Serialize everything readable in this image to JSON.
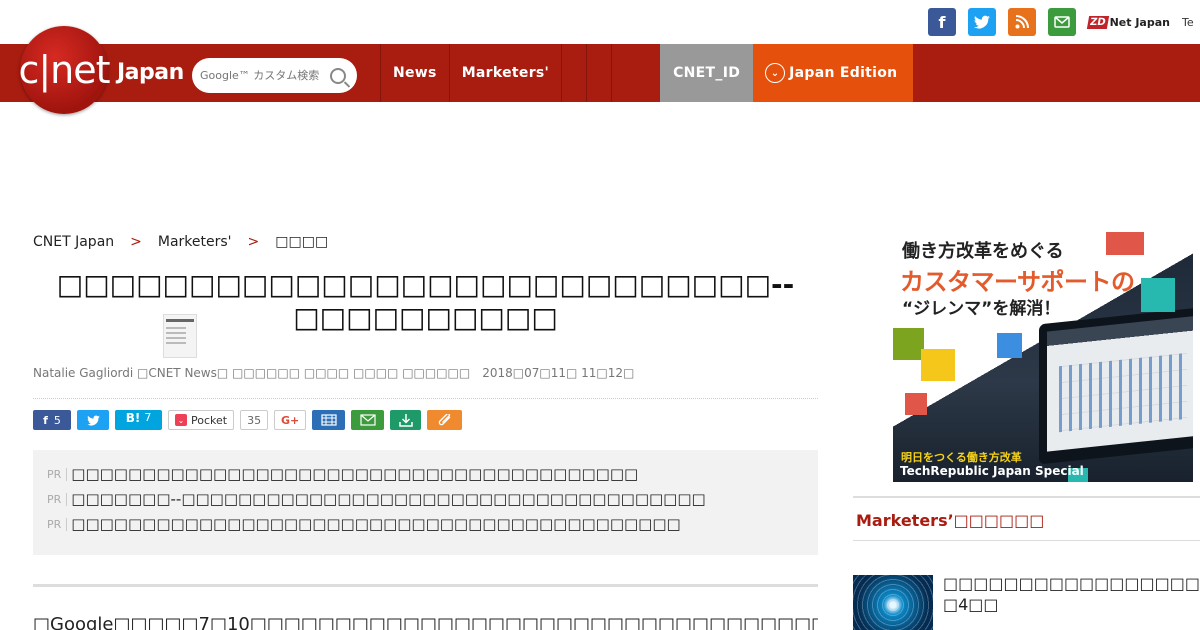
{
  "header_links": {
    "zdnet_label": "Net Japan",
    "zdnet_badge": "ZD",
    "techrepublic_label": "Te"
  },
  "logo": {
    "mark": "c|net",
    "edition": "Japan"
  },
  "search": {
    "placeholder": "Google™ カスタム検索"
  },
  "nav": {
    "items": [
      "News",
      "Marketers'"
    ],
    "cnet_id": "CNET_ID",
    "edition": "Japan Edition"
  },
  "breadcrumb": {
    "items": [
      "CNET Japan",
      "Marketers'",
      "□□□□"
    ],
    "separator": ">"
  },
  "article": {
    "title": "□□□□□□□□□□□□□□□□□□□□□□□□□□□--□□□□□□□□□□",
    "author": "Natalie Gagliordi □CNET News□ □□□□□□ □□□□ □□□□ □□□□□□",
    "date": "2018□07□11□ 11□12□",
    "share": {
      "facebook_count": "5",
      "hatena_count": "7",
      "pocket_label": "Pocket",
      "pocket_count": "35",
      "gplus_label": "G+"
    },
    "pr_items": [
      "□□□□□□□□□□□□□□□□□□□□□□□□□□□□□□□□□□□□□□□□",
      "□□□□□□□--□□□□□□□□□□□□□□□□□□□□□□□□□□□□□□□□□□□□□",
      "□□□□□□□□□□□□□□□□□□□□□□□□□□□□□□□□□□□□□□□□□□□"
    ],
    "pr_tag": "PR",
    "body_start": "□Google□□□□□7□10□□□□□□□□□□□□□□□□□□□□□□□□□□□□□□□□□□□□□",
    "body_link": "□□□□□□□□",
    "body_end": "□□□□□□□"
  },
  "ad": {
    "line1": "働き方改革をめぐる",
    "line2": "カスタマーサポートの",
    "line3": "“ジレンマ”を解消！",
    "caption1": "明日をつくる働き方改革",
    "caption2": "TechRepublic Japan Special"
  },
  "sidebar": {
    "heading": "Marketers’□□□□□□",
    "items": [
      {
        "title": "□□□□□□□□□□□□□□□□□□□□□□□□□□□□□□□□□□□□□□□□□□□□",
        "subtitle": "□4□□"
      }
    ]
  },
  "colors": {
    "header_red": "#a91c10",
    "edition_orange": "#e5500c",
    "cnet_id_gray": "#999999",
    "link_blue": "#1a8fd3",
    "facebook": "#3b5998",
    "twitter": "#1da1f2",
    "rss": "#e8711b",
    "mail": "#3c9b3c"
  }
}
